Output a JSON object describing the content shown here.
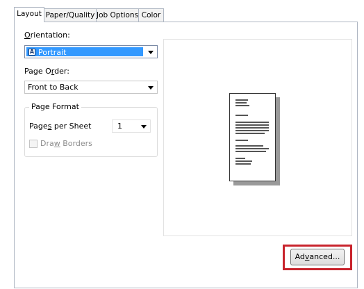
{
  "tabs": [
    "Layout",
    "Paper/Quality",
    "Job Options",
    "Color"
  ],
  "orientation": {
    "label": "Orientation:",
    "value": "Portrait",
    "icon": "portrait-page-icon"
  },
  "page_order": {
    "label": "Page Order:",
    "value": "Front to Back"
  },
  "page_format": {
    "legend": "Page Format",
    "pages_per_sheet_label": "Pages per Sheet",
    "pages_per_sheet_value": "1",
    "draw_borders_label": "Draw Borders",
    "draw_borders_checked": false,
    "draw_borders_enabled": false
  },
  "advanced_button": "Advanced...",
  "colors": {
    "selection": "#3399ff",
    "highlight": "#c8232c",
    "disabled_text": "#8c8c8c"
  }
}
